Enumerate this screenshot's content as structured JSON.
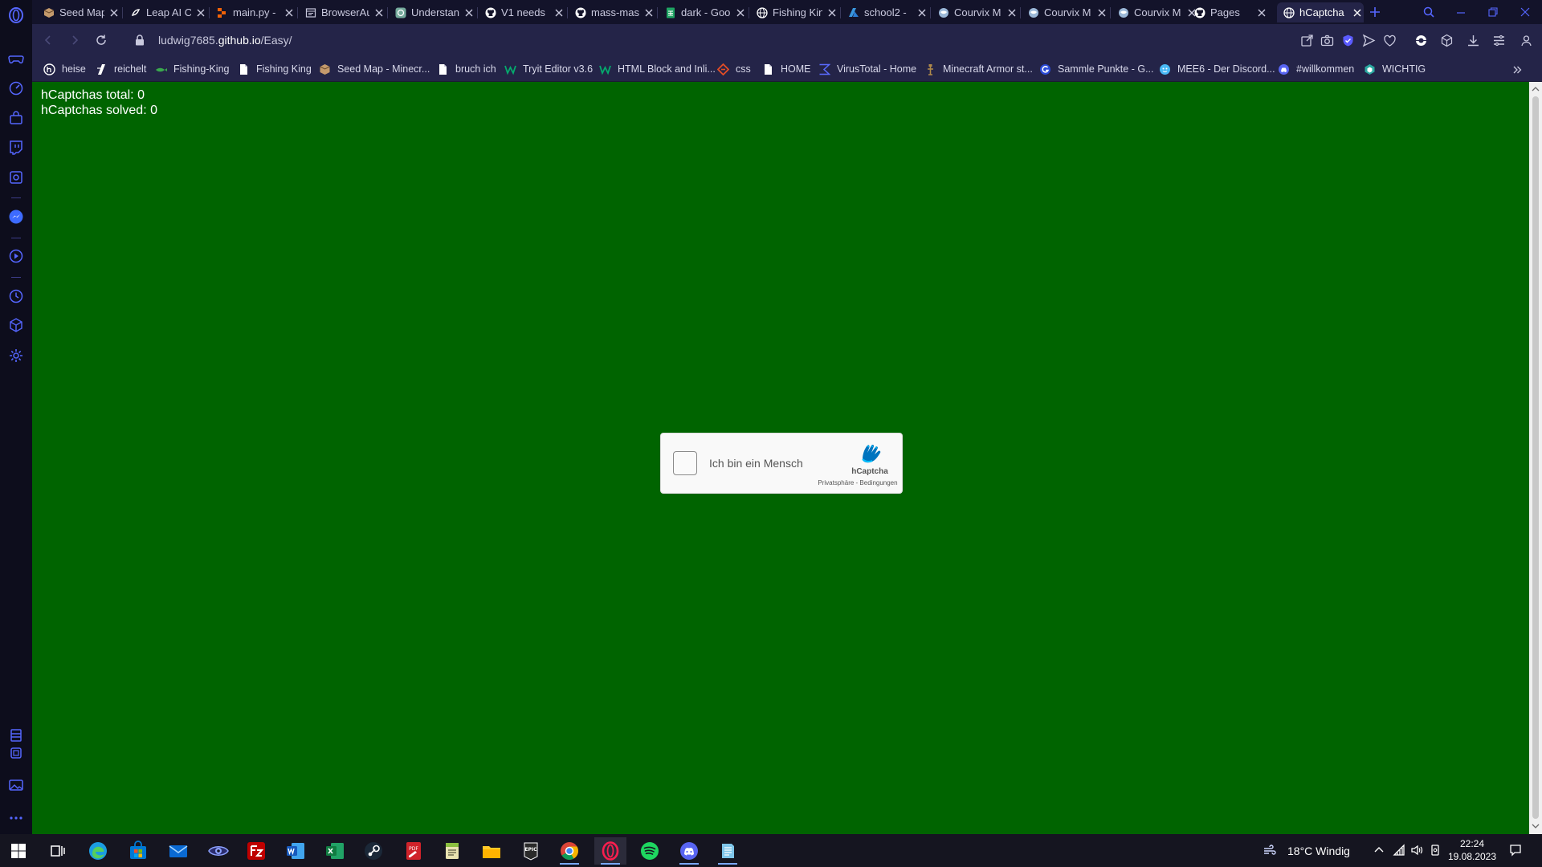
{
  "tabs": [
    {
      "label": "Seed Map",
      "active": false
    },
    {
      "label": "Leap AI Co",
      "active": false
    },
    {
      "label": "main.py -",
      "active": false
    },
    {
      "label": "BrowserAu",
      "active": false
    },
    {
      "label": "Understan",
      "active": false
    },
    {
      "label": "V1 needs",
      "active": false
    },
    {
      "label": "mass-mas",
      "active": false
    },
    {
      "label": "dark - Goo",
      "active": false
    },
    {
      "label": "Fishing Kin",
      "active": false
    },
    {
      "label": "school2 -",
      "active": false
    },
    {
      "label": "Courvix M",
      "active": false
    },
    {
      "label": "Courvix M",
      "active": false
    },
    {
      "label": "Courvix M",
      "active": false
    },
    {
      "label": "Pages",
      "active": false
    },
    {
      "label": "hCaptcha",
      "active": true
    }
  ],
  "address": {
    "host": "ludwig7685.",
    "domain": "github.io",
    "path": "/Easy/"
  },
  "bookmarks": [
    {
      "label": "heise",
      "icon": "heise-icon"
    },
    {
      "label": "reichelt",
      "icon": "reichelt-icon"
    },
    {
      "label": "Fishing-King",
      "icon": "fishing-king-icon"
    },
    {
      "label": "Fishing King",
      "icon": "page-icon"
    },
    {
      "label": "Seed Map - Minecr...",
      "icon": "seedmap-icon"
    },
    {
      "label": "bruch ich",
      "icon": "page-icon"
    },
    {
      "label": "Tryit Editor v3.6",
      "icon": "w3schools-icon"
    },
    {
      "label": "HTML Block and Inli...",
      "icon": "w3schools-icon"
    },
    {
      "label": "css",
      "icon": "css-icon"
    },
    {
      "label": "HOME",
      "icon": "page-icon"
    },
    {
      "label": "VirusTotal - Home",
      "icon": "virustotal-icon"
    },
    {
      "label": "Minecraft Armor st...",
      "icon": "armor-stand-icon"
    },
    {
      "label": "Sammle Punkte - G...",
      "icon": "g-icon"
    },
    {
      "label": "MEE6 - Der Discord...",
      "icon": "mee6-icon"
    },
    {
      "label": "#willkommen",
      "icon": "discord-icon"
    },
    {
      "label": "WICHTIG",
      "icon": "hex-icon"
    }
  ],
  "page": {
    "total_line": "hCaptchas total: 0",
    "solved_line": "hCaptchas solved: 0"
  },
  "captcha": {
    "label": "Ich bin ein Mensch",
    "brand": "hCaptcha",
    "links": "Privatsphäre - Bedingungen",
    "checked": false
  },
  "tray": {
    "weather": "18°C  Windig",
    "time": "22:24",
    "date": "19.08.2023"
  },
  "colors": {
    "page_background": "#006400",
    "browser_chrome": "#242448",
    "tab_strip": "#13132a",
    "sidebar": "#0d0d1c",
    "accent": "#4a5cff"
  }
}
